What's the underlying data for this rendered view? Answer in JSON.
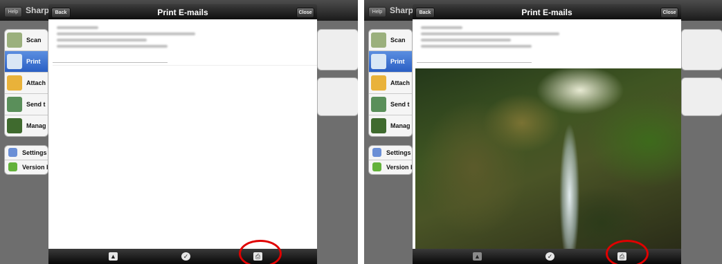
{
  "app": {
    "help_label": "Help",
    "title": "Sharp"
  },
  "sidebar": {
    "items": [
      {
        "label": "Scan",
        "color": "#9bb07d"
      },
      {
        "label": "Print",
        "color": "#d9e7f5"
      },
      {
        "label": "Attach",
        "color": "#e9b23a"
      },
      {
        "label": "Send t",
        "color": "#5a8f5a"
      },
      {
        "label": "Manag",
        "color": "#3f6a2e"
      }
    ],
    "settings": [
      {
        "label": "Settings",
        "color": "#6b8fd6"
      },
      {
        "label": "Version I",
        "color": "#63b23b"
      }
    ]
  },
  "modal": {
    "back_label": "Back",
    "title": "Print E-mails",
    "close_label": "Close"
  },
  "toolbar": {
    "left_icon": "image-icon",
    "center_icon": "checkmark-icon",
    "right_icon": "printer-settings-icon"
  },
  "annotation": {
    "color": "#e00000"
  }
}
